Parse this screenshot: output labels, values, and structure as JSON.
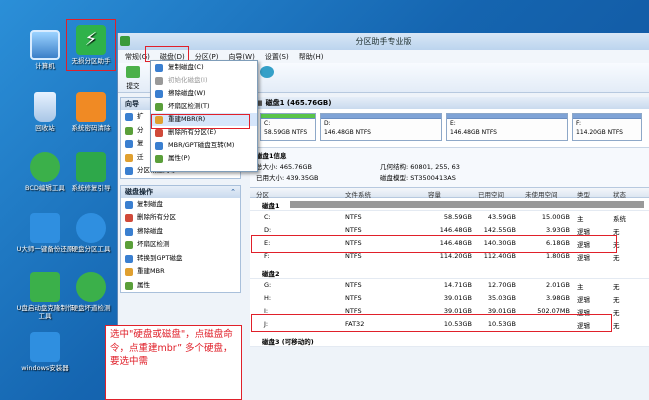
{
  "desktop": {
    "icons": [
      {
        "label": "计算机",
        "icon": "computer-icon"
      },
      {
        "label": "无损分区助手",
        "icon": "partition-assistant-icon",
        "color": "#2fb24a"
      },
      {
        "label": "回收站",
        "icon": "recycle-bin-icon"
      },
      {
        "label": "系统密码清除",
        "icon": "password-clear-icon",
        "color": "#f08a24"
      },
      {
        "label": "BCD编辑工具",
        "icon": "bcd-tool-icon",
        "color": "#3bb04a"
      },
      {
        "label": "系统修复引导",
        "icon": "boot-repair-icon",
        "color": "#2ea84a"
      },
      {
        "label": "U大师一键备份还原",
        "icon": "backup-restore-icon",
        "color": "#2f8fe0"
      },
      {
        "label": "硬盘分区工具",
        "icon": "disk-partition-icon",
        "color": "#2f8fe0"
      },
      {
        "label": "U盘启动盘克隆制作工具",
        "icon": "usb-clone-icon",
        "color": "#3bb04a"
      },
      {
        "label": "硬盘坏道检测",
        "icon": "bad-sector-icon",
        "color": "#3bb04a"
      },
      {
        "label": "windows安装器",
        "icon": "windows-installer-icon",
        "color": "#2f8fe0"
      }
    ]
  },
  "window": {
    "title": "分区助手专业版",
    "menu": [
      "常规(G)",
      "磁盘(D)",
      "分区(P)",
      "向导(W)",
      "设置(S)",
      "帮助(H)"
    ],
    "toolbar": {
      "submit": "提交"
    }
  },
  "dropdown": {
    "items": [
      {
        "label": "复制磁盘(C)",
        "icon": "copy-disk-icon",
        "disabled": false
      },
      {
        "label": "初始化磁盘(I)",
        "icon": "init-disk-icon",
        "disabled": true
      },
      {
        "label": "擦除磁盘(W)",
        "icon": "wipe-disk-icon",
        "disabled": false
      },
      {
        "label": "坏扇区检测(T)",
        "icon": "bad-sector-check-icon",
        "disabled": false
      },
      {
        "label": "重建MBR(R)",
        "icon": "rebuild-mbr-icon",
        "disabled": false,
        "highlighted": true
      },
      {
        "label": "删除所有分区(E)",
        "icon": "delete-partitions-icon",
        "disabled": false
      },
      {
        "label": "MBR/GPT磁盘互转(M)",
        "icon": "convert-disk-icon",
        "disabled": false
      },
      {
        "label": "属性(P)",
        "icon": "properties-icon",
        "disabled": false
      }
    ]
  },
  "leftpane": {
    "wizard": {
      "title": "向导",
      "items": [
        "扩",
        "分",
        "复",
        "迁",
        "分区恢复向导"
      ]
    },
    "diskops": {
      "title": "磁盘操作",
      "items": [
        "复制磁盘",
        "删除所有分区",
        "擦除磁盘",
        "坏扇区检测",
        "转换到GPT磁盘",
        "重建MBR",
        "属性"
      ]
    }
  },
  "rightpane": {
    "disk1_header": "磁盘1 (465.76GB)",
    "cards": [
      {
        "drive": "C:",
        "size": "58.59GB NTFS",
        "used_fraction": 0.3
      },
      {
        "drive": "D:",
        "size": "146.48GB NTFS",
        "used_fraction": 0.1
      },
      {
        "drive": "E:",
        "size": "146.48GB NTFS",
        "used_fraction": 0.1
      },
      {
        "drive": "F:",
        "size": "114.20GB NTFS",
        "used_fraction": 0.1
      }
    ],
    "info": {
      "title": "磁盘1信息",
      "size": "总大小: 465.76GB",
      "cylinders": "几何结构: 60801, 255, 63",
      "used": "已用大小: 439.35GB",
      "model": "磁盘模型: ST3500413AS"
    },
    "columns": [
      "分区",
      "文件系统",
      "容量",
      "已用空间",
      "未使用空间",
      "类型",
      "状态"
    ],
    "groups": [
      {
        "title": "磁盘1",
        "rows": [
          [
            "C:",
            "NTFS",
            "58.59GB",
            "43.59GB",
            "15.00GB",
            "主",
            "系统"
          ],
          [
            "D:",
            "NTFS",
            "146.48GB",
            "142.55GB",
            "3.93GB",
            "逻辑",
            "无"
          ],
          [
            "E:",
            "NTFS",
            "146.48GB",
            "140.30GB",
            "6.18GB",
            "逻辑",
            "无"
          ],
          [
            "F:",
            "NTFS",
            "114.20GB",
            "112.40GB",
            "1.80GB",
            "逻辑",
            "无"
          ]
        ]
      },
      {
        "title": "磁盘2",
        "rows": [
          [
            "G:",
            "NTFS",
            "14.71GB",
            "12.70GB",
            "2.01GB",
            "主",
            "无"
          ],
          [
            "H:",
            "NTFS",
            "39.01GB",
            "35.03GB",
            "3.98GB",
            "逻辑",
            "无"
          ],
          [
            "I:",
            "NTFS",
            "39.01GB",
            "39.01GB",
            "502.07MB",
            "逻辑",
            "无"
          ],
          [
            "J:",
            "FAT32",
            "10.53GB",
            "10.53GB",
            "",
            "逻辑",
            "无"
          ]
        ]
      },
      {
        "title": "磁盘3 (可移动的)",
        "rows": []
      }
    ]
  },
  "annotation": "选中\"硬盘或磁盘\"，点磁盘命令，点重建mbr” 多个硬盘，要选中需"
}
